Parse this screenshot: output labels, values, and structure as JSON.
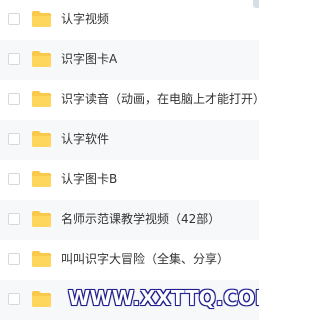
{
  "file_list": {
    "items": [
      {
        "name": "认字视频",
        "icon": "folder-icon"
      },
      {
        "name": "识字图卡A",
        "icon": "folder-icon"
      },
      {
        "name": "识字读音（动画，在电脑上才能打开）",
        "icon": "folder-icon"
      },
      {
        "name": "认字软件",
        "icon": "folder-icon"
      },
      {
        "name": "认字图卡B",
        "icon": "folder-icon"
      },
      {
        "name": "名师示范课教学视频（42部）",
        "icon": "folder-icon"
      },
      {
        "name": "叫叫识字大冒险（全集、分享）",
        "icon": "folder-icon"
      },
      {
        "name": "",
        "icon": "folder-icon"
      }
    ],
    "folder_color": "#f8c94a"
  },
  "watermark": {
    "text": "WWW.XXTTQ.COM"
  }
}
